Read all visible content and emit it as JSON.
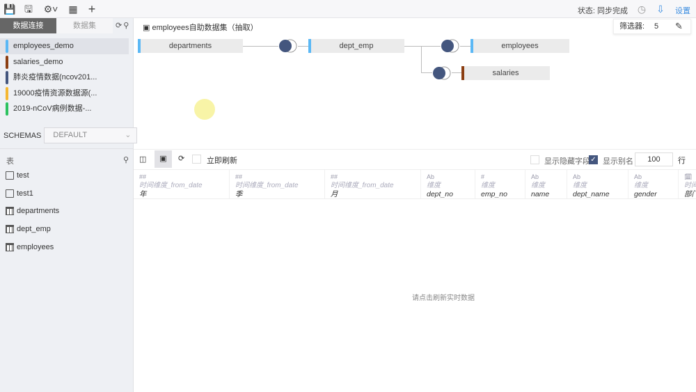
{
  "toolbar": {
    "status": "状态: 同步完成",
    "settings": "设置"
  },
  "sidebar": {
    "tabs": [
      "数据连接",
      "数据集"
    ],
    "connections": [
      {
        "name": "employees_demo",
        "color": "#5bb8f5"
      },
      {
        "name": "salaries_demo",
        "color": "#8b3e12"
      },
      {
        "name": "肺炎疫情数据(ncov201...",
        "color": "#44567e"
      },
      {
        "name": "19000疫情资源数据源(...",
        "color": "#f5b731"
      },
      {
        "name": "2019-nCoV病例数据-...",
        "color": "#2dc25f"
      }
    ],
    "schemas_label": "SCHEMAS",
    "schema_value": "DEFAULT",
    "tables_label": "表",
    "tables": [
      {
        "name": "test",
        "type": "sql"
      },
      {
        "name": "test1",
        "type": "sql"
      },
      {
        "name": "departments",
        "type": "table"
      },
      {
        "name": "dept_emp",
        "type": "table"
      },
      {
        "name": "employees",
        "type": "table"
      }
    ]
  },
  "canvas": {
    "title": "employees自助数据集（抽取）",
    "filter_label": "筛选器:",
    "filter_count": "5",
    "nodes": [
      {
        "name": "departments",
        "color": "#5bb8f5"
      },
      {
        "name": "dept_emp",
        "color": "#5bb8f5"
      },
      {
        "name": "employees",
        "color": "#5bb8f5"
      },
      {
        "name": "salaries",
        "color": "#8b3e12"
      }
    ]
  },
  "preview": {
    "instant_refresh": "立即刷新",
    "show_hidden": "显示隐藏字段",
    "show_alias": "显示别名",
    "show_alias_checked": true,
    "rows": "100",
    "rows_unit": "行",
    "columns": [
      {
        "type": "##",
        "group": "时间维度_from_date",
        "name": "年"
      },
      {
        "type": "##",
        "group": "时间维度_from_date",
        "name": "季"
      },
      {
        "type": "##",
        "group": "时间维度_from_date",
        "name": "月"
      },
      {
        "type": "Ab",
        "group": "维度",
        "name": "dept_no"
      },
      {
        "type": "#",
        "group": "维度",
        "name": "emp_no"
      },
      {
        "type": "Ab",
        "group": "维度",
        "name": "name"
      },
      {
        "type": "Ab",
        "group": "维度",
        "name": "dept_name"
      },
      {
        "type": "Ab",
        "group": "维度",
        "name": "gender"
      },
      {
        "type": "date",
        "group": "时间",
        "name": "部门"
      }
    ],
    "empty_message": "请点击刷新实时数据"
  }
}
